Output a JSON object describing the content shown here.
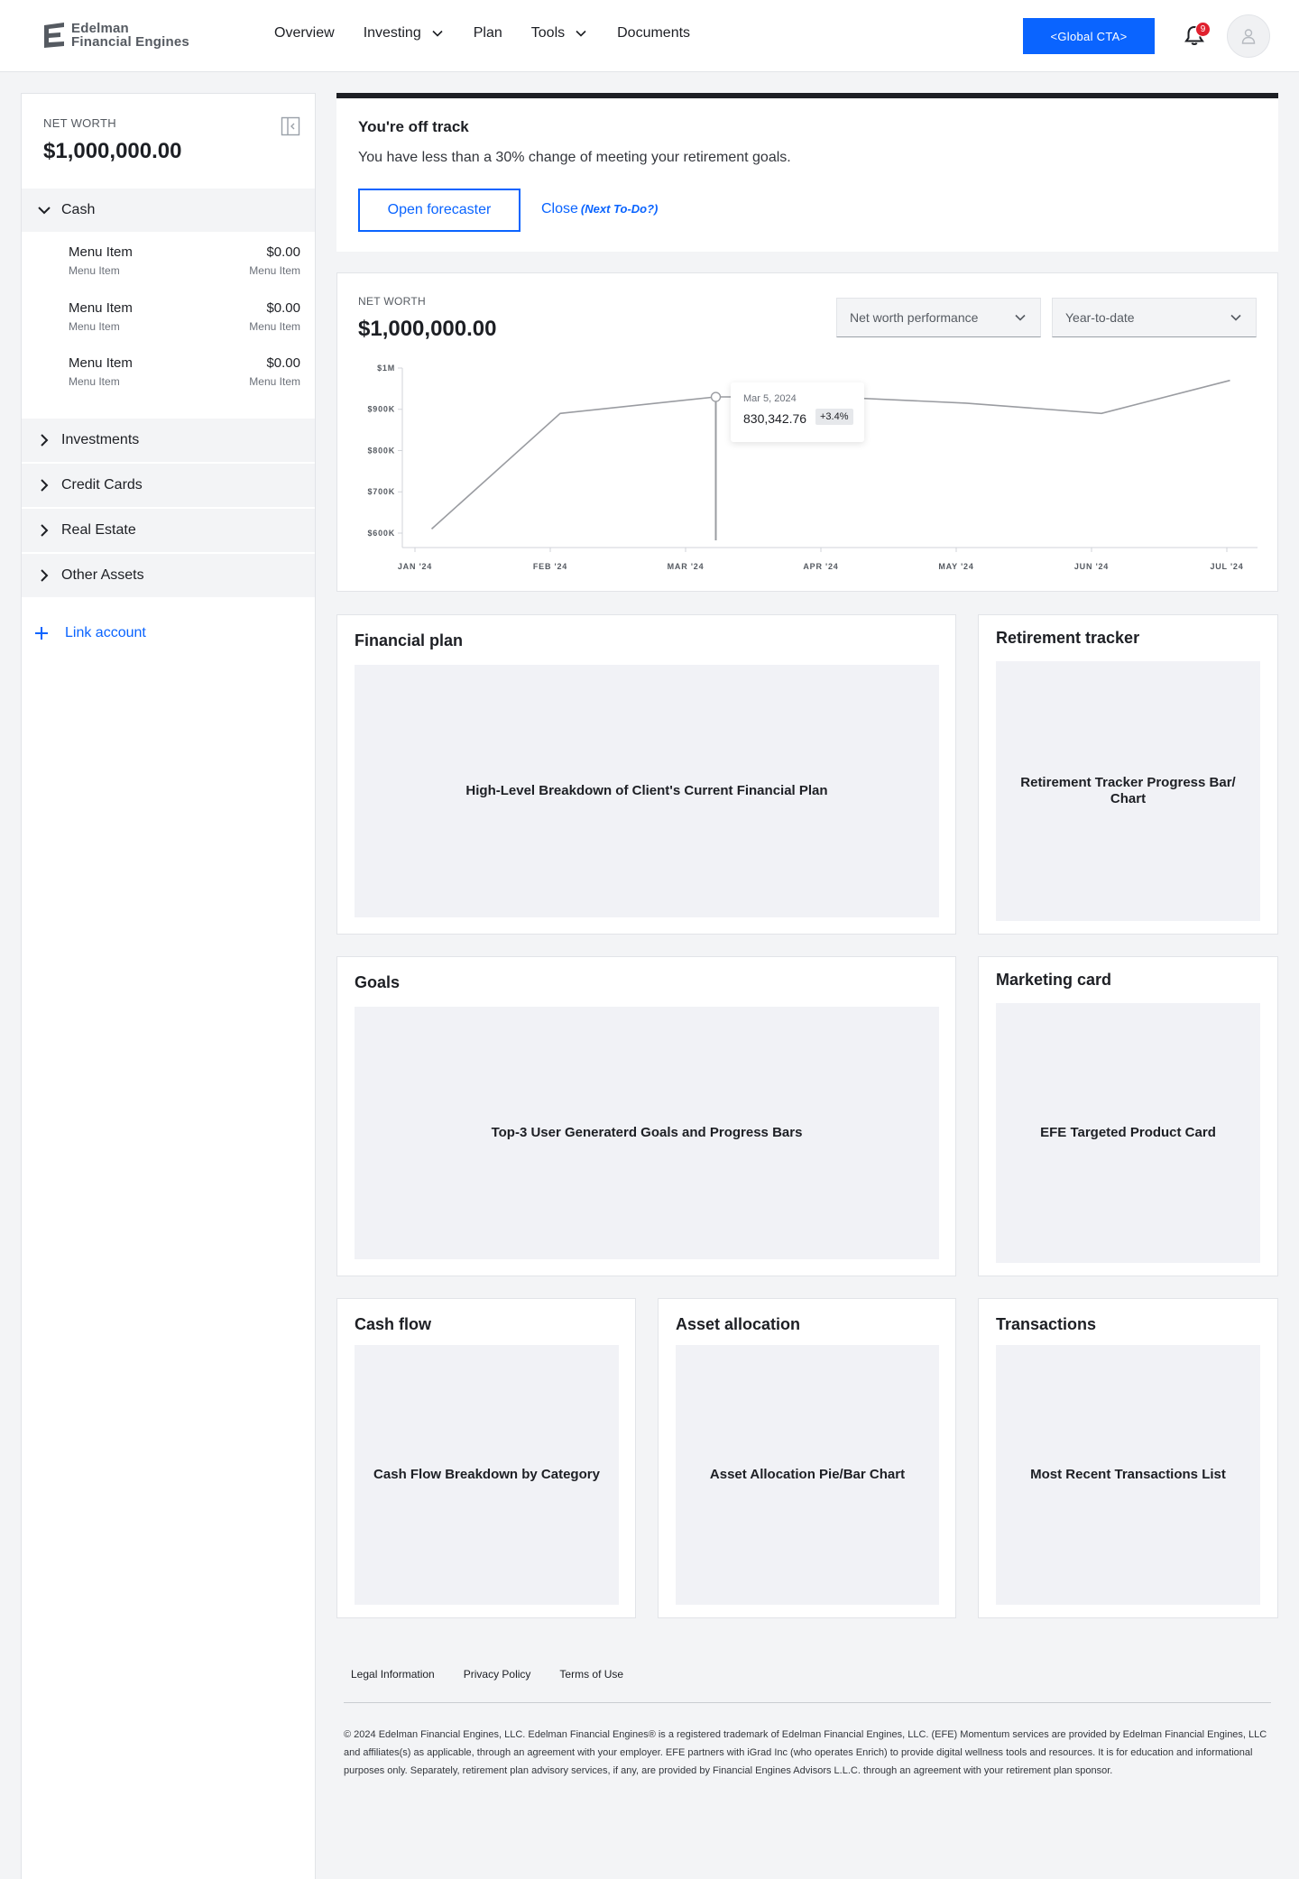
{
  "brand": {
    "line1": "Edelman",
    "line2": "Financial Engines",
    "primary": "#0a64ff",
    "alert": "#e0202e"
  },
  "nav": {
    "overview": "Overview",
    "investing": "Investing",
    "plan": "Plan",
    "tools": "Tools",
    "documents": "Documents"
  },
  "header": {
    "cta": "<Global CTA>",
    "notifications": "9"
  },
  "sidebar": {
    "net_worth_label": "NET WORTH",
    "net_worth_value": "$1,000,000.00",
    "cash": "Cash",
    "cash_items": [
      {
        "title": "Menu Item",
        "desc": "Menu Item",
        "amount": "$0.00",
        "amount_desc": "Menu Item"
      },
      {
        "title": "Menu Item",
        "desc": "Menu Item",
        "amount": "$0.00",
        "amount_desc": "Menu Item"
      },
      {
        "title": "Menu Item",
        "desc": "Menu Item",
        "amount": "$0.00",
        "amount_desc": "Menu Item"
      }
    ],
    "sections": [
      "Investments",
      "Credit Cards",
      "Real Estate",
      "Other Assets"
    ],
    "link_account": "Link account"
  },
  "alert": {
    "title": "You're off track",
    "body": "You have less than a 30% change of meeting your retirement goals.",
    "primary_btn": "Open forecaster",
    "secondary_btn": "Close",
    "secondary_note": "(Next To-Do?)"
  },
  "net_worth_card": {
    "label": "NET WORTH",
    "value": "$1,000,000.00",
    "metric_select": "Net worth performance",
    "range_select": "Year-to-date"
  },
  "chart_data": {
    "type": "line",
    "x": [
      "JAN '24",
      "FEB '24",
      "MAR '24",
      "APR '24",
      "MAY '24",
      "JUN '24",
      "JUL '24"
    ],
    "y_ticks": [
      "$1M",
      "$900K",
      "$800K",
      "$700K",
      "$600K"
    ],
    "ylim": [
      565000,
      1000000
    ],
    "points": [
      {
        "x": 0.05,
        "y": 610000
      },
      {
        "x": 1.0,
        "y": 890000
      },
      {
        "x": 2.15,
        "y": 930000
      },
      {
        "x": 3.0,
        "y": 930000
      },
      {
        "x": 4.0,
        "y": 915000
      },
      {
        "x": 5.0,
        "y": 890000
      },
      {
        "x": 5.95,
        "y": 970000
      }
    ],
    "highlight_index": 2,
    "tooltip": {
      "date": "Mar 5, 2024",
      "value": "830,342.76",
      "change": "+3.4%"
    },
    "grid": false,
    "line_color": "#9a9ca1"
  },
  "cards": {
    "financial_plan": {
      "title": "Financial plan",
      "body": "High-Level Breakdown of Client's Current Financial Plan"
    },
    "retirement": {
      "title": "Retirement tracker",
      "body": "Retirement Tracker Progress Bar/ Chart"
    },
    "goals": {
      "title": "Goals",
      "body": "Top-3 User Generaterd Goals and Progress Bars"
    },
    "marketing": {
      "title": "Marketing card",
      "body": "EFE Targeted Product Card"
    },
    "cash_flow": {
      "title": "Cash flow",
      "body": "Cash Flow Breakdown by Category"
    },
    "asset_allocation": {
      "title": "Asset allocation",
      "body": "Asset Allocation Pie/Bar Chart"
    },
    "transactions": {
      "title": "Transactions",
      "body": "Most Recent Transactions List"
    }
  },
  "footer": {
    "links": [
      "Legal Information",
      "Privacy Policy",
      "Terms of Use"
    ],
    "legal": "© 2024 Edelman Financial Engines, LLC. Edelman Financial Engines® is a registered trademark of Edelman Financial Engines, LLC. (EFE) Momentum services are provided by Edelman Financial Engines, LLC and affiliates(s) as applicable, through an agreement with your employer. EFE partners with iGrad Inc (who operates Enrich) to provide digital wellness tools and resources. It is for education and informational purposes only. Separately, retirement plan advisory services, if any, are provided by Financial Engines Advisors L.L.C. through an agreement with your retirement plan sponsor."
  }
}
